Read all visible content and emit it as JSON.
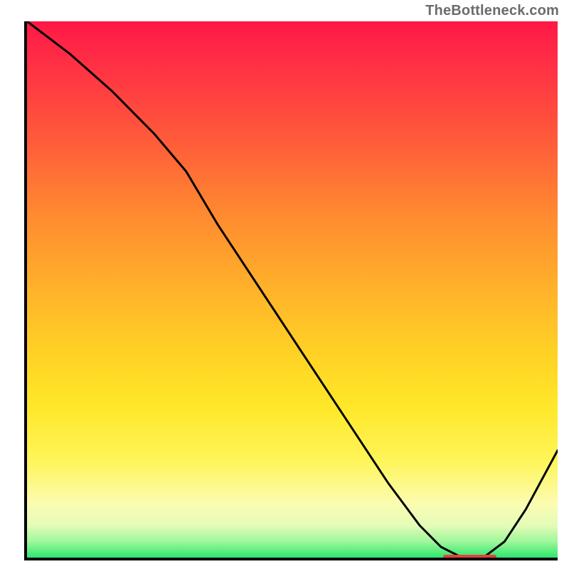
{
  "attribution": "TheBottleneck.com",
  "colors": {
    "axis": "#000000",
    "curve": "#000000",
    "trough_marker": "#e4403f",
    "gradient_top": "#ff1846",
    "gradient_bottom": "#2ee66e"
  },
  "chart_data": {
    "type": "line",
    "title": "",
    "xlabel": "",
    "ylabel": "",
    "xlim": [
      0,
      100
    ],
    "ylim": [
      0,
      100
    ],
    "grid": false,
    "legend": false,
    "series": [
      {
        "name": "bottleneck-curve",
        "x": [
          0,
          8,
          16,
          24,
          30,
          36,
          44,
          52,
          60,
          68,
          74,
          78,
          82,
          86,
          90,
          94,
          100
        ],
        "y": [
          100,
          94,
          87,
          79,
          72,
          62,
          50,
          38,
          26,
          14,
          6,
          2,
          0,
          0,
          3,
          9,
          20
        ]
      }
    ],
    "annotations": [
      {
        "name": "trough-marker",
        "x_start": 78,
        "x_end": 88,
        "y": 0.6
      }
    ]
  }
}
